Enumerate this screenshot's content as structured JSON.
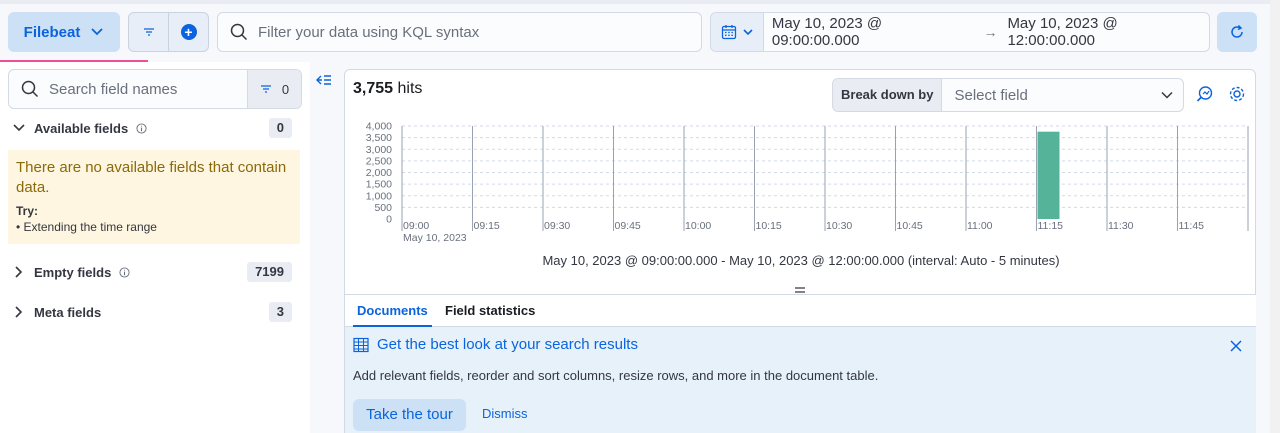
{
  "header": {
    "data_view_label": "Filebeat",
    "query_placeholder": "Filter your data using KQL syntax",
    "date_start": "May 10, 2023 @ 09:00:00.000",
    "date_end": "May 10, 2023 @ 12:00:00.000"
  },
  "sidebar": {
    "search_placeholder": "Search field names",
    "filter_count": "0",
    "available": {
      "label": "Available fields",
      "count": "0"
    },
    "callout": {
      "message": "There are no available fields that contain data.",
      "try_label": "Try:",
      "suggestion": "Extending the time range"
    },
    "empty": {
      "label": "Empty fields",
      "count": "7199"
    },
    "meta": {
      "label": "Meta fields",
      "count": "3"
    }
  },
  "main": {
    "hits_count": "3,755",
    "hits_label": "hits",
    "breakdown_label": "Break down by",
    "breakdown_placeholder": "Select field",
    "interval_text": "May 10, 2023 @ 09:00:00.000 - May 10, 2023 @ 12:00:00.000 (interval: Auto - 5 minutes)",
    "tabs": [
      {
        "label": "Documents"
      },
      {
        "label": "Field statistics"
      }
    ],
    "tour": {
      "title": "Get the best look at your search results",
      "description": "Add relevant fields, reorder and sort columns, resize rows, and more in the document table.",
      "cta": "Take the tour",
      "dismiss": "Dismiss"
    }
  },
  "chart_data": {
    "type": "bar",
    "ylim": [
      0,
      4000
    ],
    "y_ticks": [
      "4,000",
      "3,500",
      "3,000",
      "2,500",
      "2,000",
      "1,500",
      "1,000",
      "500",
      "0"
    ],
    "x_ticks": [
      "09:00",
      "09:15",
      "09:30",
      "09:45",
      "10:00",
      "10:15",
      "10:30",
      "10:45",
      "11:00",
      "11:15",
      "11:30",
      "11:45"
    ],
    "x_sublabel": "May 10, 2023",
    "bars": [
      {
        "x": "11:15",
        "value": 3755
      }
    ],
    "bar_color": "#54b399"
  }
}
